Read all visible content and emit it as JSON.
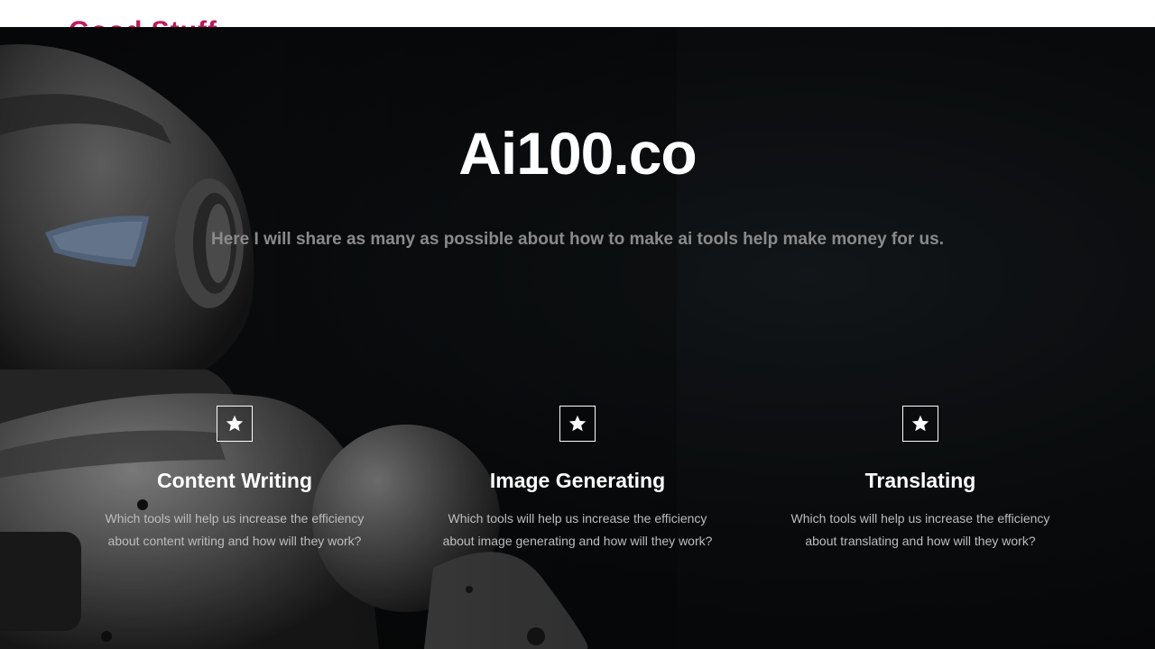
{
  "header": {
    "logo_text": "Good Stuff"
  },
  "hero": {
    "title": "Ai100.co",
    "subtitle": "Here I will share as many as possible about how to make ai tools help make money for us.",
    "background_image": "robot-photo"
  },
  "features": [
    {
      "icon": "star-icon",
      "title": "Content Writing",
      "description_line1": "Which tools will help us increase the efficiency",
      "description_line2": "about content writing and how will they work?"
    },
    {
      "icon": "star-icon",
      "title": "Image Generating",
      "description_line1": "Which tools will help us increase the efficiency",
      "description_line2": "about image generating and how will they work?"
    },
    {
      "icon": "star-icon",
      "title": "Translating",
      "description_line1": "Which tools will help us increase the efficiency",
      "description_line2": "about translating and how will they work?"
    }
  ],
  "colors": {
    "logo": "#c2185b",
    "hero_background": "#0b0d0f",
    "title": "#ffffff",
    "subtitle": "#8a8a8a",
    "feature_text": "#bdbdbd"
  }
}
